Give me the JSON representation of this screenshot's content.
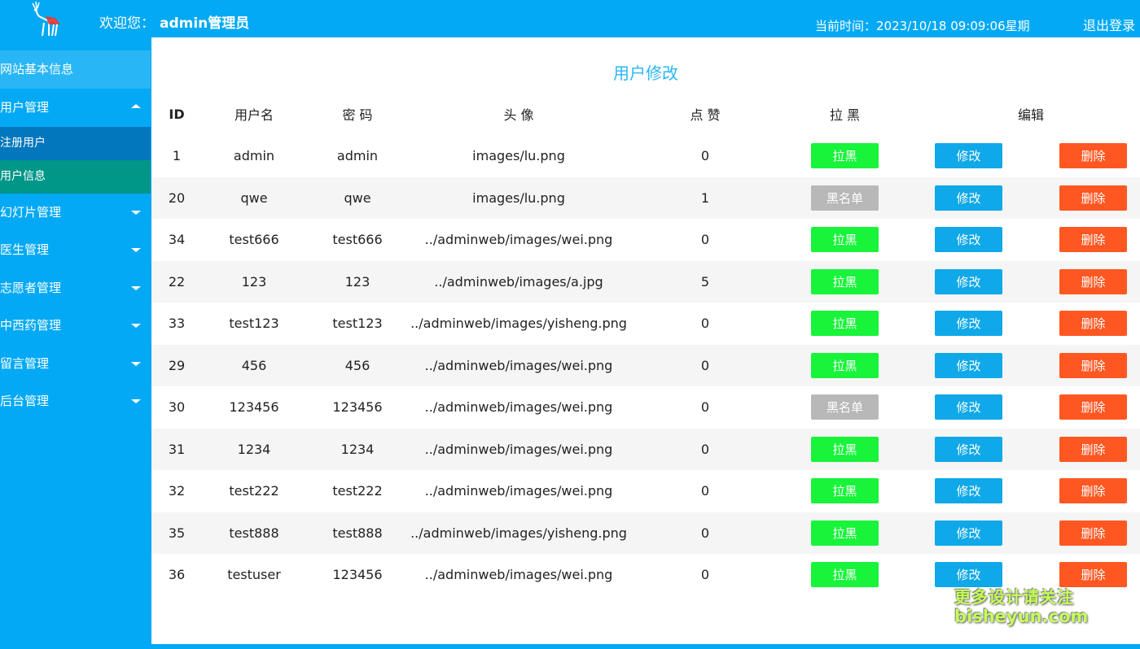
{
  "header": {
    "welcome_label": "欢迎您：",
    "user_name": "admin管理员",
    "time_label": "当前时间：",
    "time_value": "2023/10/18 09:09:06星期",
    "logout_label": "退出登录"
  },
  "sidebar": {
    "items": [
      {
        "label": "网站基本信息"
      },
      {
        "label": "用户管理"
      },
      {
        "label": "幻灯片管理"
      },
      {
        "label": "医生管理"
      },
      {
        "label": "志愿者管理"
      },
      {
        "label": "中西药管理"
      },
      {
        "label": "留言管理"
      },
      {
        "label": "后台管理"
      }
    ],
    "subitems": [
      {
        "label": "注册用户"
      },
      {
        "label": "用户信息"
      }
    ]
  },
  "main": {
    "title": "用户修改",
    "columns": {
      "id": "ID",
      "username": "用户名",
      "password": "密 码",
      "avatar": "头 像",
      "likes": "点 赞",
      "blacklist": "拉 黑",
      "edit": "编辑"
    },
    "rows": [
      {
        "id": "1",
        "username": "admin",
        "password": "admin",
        "avatar": "images/lu.png",
        "likes": "0",
        "status": "拉黑",
        "edit": "修改",
        "delete": "删除"
      },
      {
        "id": "20",
        "username": "qwe",
        "password": "qwe",
        "avatar": "images/lu.png",
        "likes": "1",
        "status": "黑名单",
        "edit": "修改",
        "delete": "删除"
      },
      {
        "id": "34",
        "username": "test666",
        "password": "test666",
        "avatar": "../adminweb/images/wei.png",
        "likes": "0",
        "status": "拉黑",
        "edit": "修改",
        "delete": "删除"
      },
      {
        "id": "22",
        "username": "123",
        "password": "123",
        "avatar": "../adminweb/images/a.jpg",
        "likes": "5",
        "status": "拉黑",
        "edit": "修改",
        "delete": "删除"
      },
      {
        "id": "33",
        "username": "test123",
        "password": "test123",
        "avatar": "../adminweb/images/yisheng.png",
        "likes": "0",
        "status": "拉黑",
        "edit": "修改",
        "delete": "删除"
      },
      {
        "id": "29",
        "username": "456",
        "password": "456",
        "avatar": "../adminweb/images/wei.png",
        "likes": "0",
        "status": "拉黑",
        "edit": "修改",
        "delete": "删除"
      },
      {
        "id": "30",
        "username": "123456",
        "password": "123456",
        "avatar": "../adminweb/images/wei.png",
        "likes": "0",
        "status": "黑名单",
        "edit": "修改",
        "delete": "删除"
      },
      {
        "id": "31",
        "username": "1234",
        "password": "1234",
        "avatar": "../adminweb/images/wei.png",
        "likes": "0",
        "status": "拉黑",
        "edit": "修改",
        "delete": "删除"
      },
      {
        "id": "32",
        "username": "test222",
        "password": "test222",
        "avatar": "../adminweb/images/wei.png",
        "likes": "0",
        "status": "拉黑",
        "edit": "修改",
        "delete": "删除"
      },
      {
        "id": "35",
        "username": "test888",
        "password": "test888",
        "avatar": "../adminweb/images/yisheng.png",
        "likes": "0",
        "status": "拉黑",
        "edit": "修改",
        "delete": "删除"
      },
      {
        "id": "36",
        "username": "testuser",
        "password": "123456",
        "avatar": "../adminweb/images/wei.png",
        "likes": "0",
        "status": "拉黑",
        "edit": "修改",
        "delete": "删除"
      }
    ]
  },
  "watermark": {
    "line1": "更多设计请关注",
    "line2": "bisheyun.com"
  },
  "colors": {
    "primary": "#03a9f4",
    "title": "#29b6f6",
    "blacklist_button": "#17f43a",
    "blacklisted_button": "#b8b8b8",
    "edit_button": "#0fa8e8",
    "delete_button": "#ff5722",
    "active_subitem": "#009688"
  }
}
